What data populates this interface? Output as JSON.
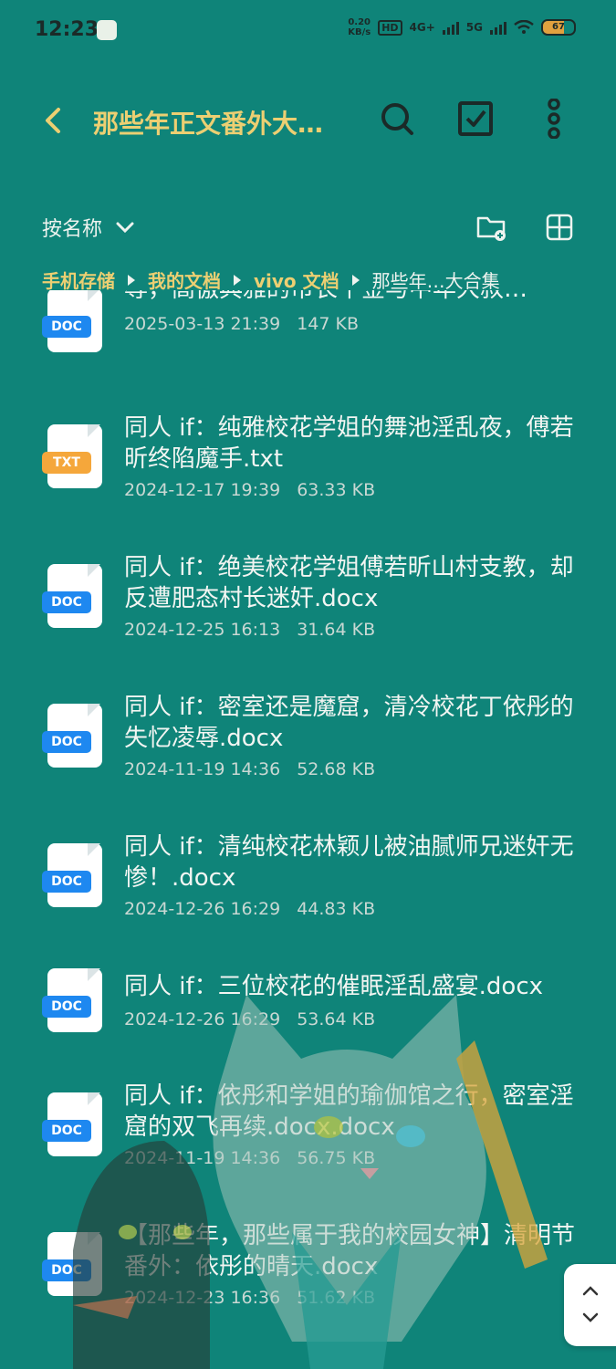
{
  "status_bar": {
    "time": "12:23",
    "net_speed_value": "0.20",
    "net_speed_unit": "KB/s",
    "hd_label": "HD",
    "network": "4G+",
    "network2": "5G",
    "battery": "67"
  },
  "header": {
    "title": "那些年正文番外大…"
  },
  "toolbar": {
    "sort_label": "按名称"
  },
  "breadcrumb": [
    "手机存储",
    "我的文档",
    "vivo 文档",
    "那些年…大合集"
  ],
  "files": [
    {
      "type": "DOC",
      "name": "辱，高傲典雅的市长千金与中年大叔…",
      "date": "2025-03-13 21:39",
      "size": "147 KB"
    },
    {
      "type": "TXT",
      "name": "同人 if：纯雅校花学姐的舞池淫乱夜，傅若昕终陷魔手.txt",
      "date": "2024-12-17 19:39",
      "size": "63.33 KB"
    },
    {
      "type": "DOC",
      "name": "同人 if：绝美校花学姐傅若昕山村支教，却反遭肥态村长迷奸.docx",
      "date": "2024-12-25 16:13",
      "size": "31.64 KB"
    },
    {
      "type": "DOC",
      "name": "同人 if：密室还是魔窟，清冷校花丁依彤的失忆凌辱.docx",
      "date": "2024-11-19 14:36",
      "size": "52.68 KB"
    },
    {
      "type": "DOC",
      "name": "同人 if：清纯校花林颖儿被油腻师兄迷奸无惨！.docx",
      "date": "2024-12-26 16:29",
      "size": "44.83 KB"
    },
    {
      "type": "DOC",
      "name": "同人 if：三位校花的催眠淫乱盛宴.docx",
      "date": "2024-12-26 16:29",
      "size": "53.64 KB"
    },
    {
      "type": "DOC",
      "name": "同人 if：依彤和学姐的瑜伽馆之行，密室淫窟的双飞再续.docx.docx",
      "date": "2024-11-19 14:36",
      "size": "56.75 KB"
    },
    {
      "type": "DOC",
      "name": "【那些年，那些属于我的校园女神】清明节番外：依彤的晴天.docx",
      "date": "2024-12-23 16:36",
      "size": "51.62 KB"
    }
  ],
  "colors": {
    "background": "#0f8479",
    "accent": "#eccf72",
    "doc_badge": "#1e88f0",
    "txt_badge": "#f5a73b"
  }
}
